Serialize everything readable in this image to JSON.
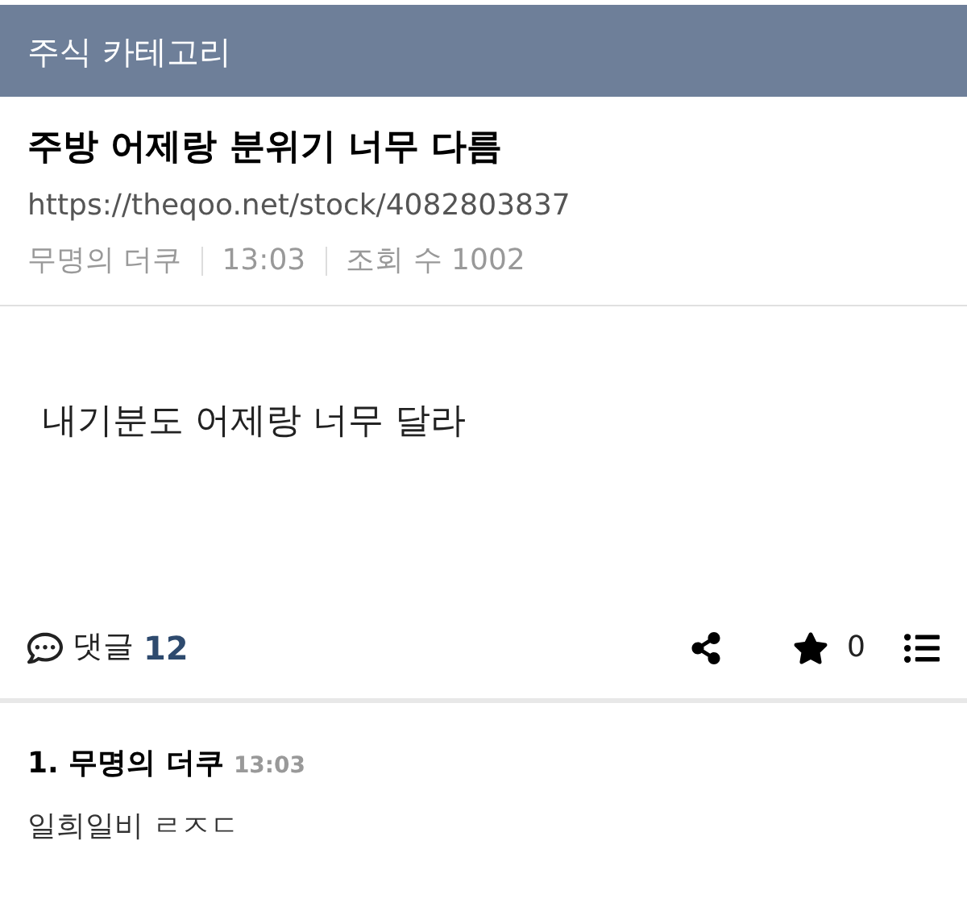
{
  "header": {
    "title": "주식 카테고리"
  },
  "post": {
    "title": "주방 어제랑 분위기 너무 다름",
    "url": "https://theqoo.net/stock/4082803837",
    "author": "무명의 더쿠",
    "time": "13:03",
    "views": "조회 수 1002",
    "body": "내기분도 어제랑 너무 달라"
  },
  "actions": {
    "comments_label": "댓글",
    "comments_count": "12",
    "stars": "0"
  },
  "comments": [
    {
      "number": "1.",
      "author": "무명의 더쿠",
      "time": "13:03",
      "text": "일희일비 ㄹㅈㄷ"
    }
  ]
}
